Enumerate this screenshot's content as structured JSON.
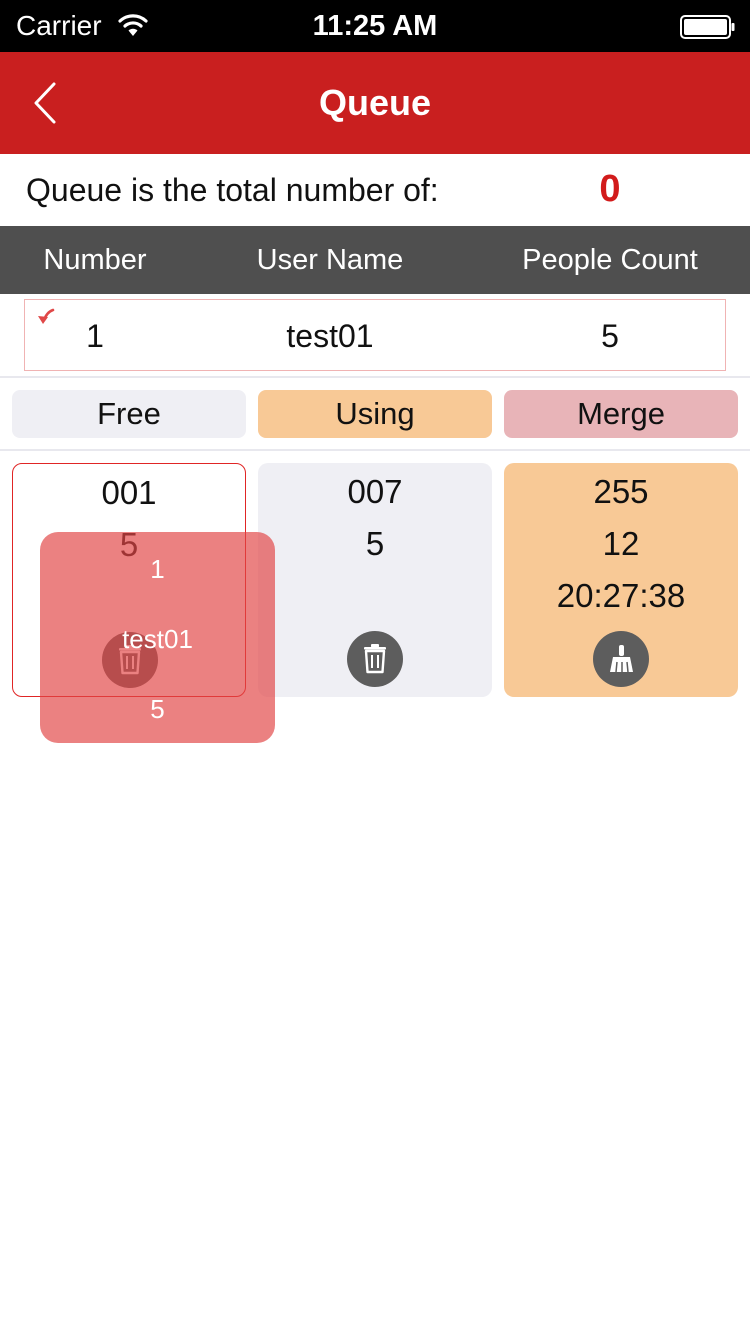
{
  "status_bar": {
    "carrier": "Carrier",
    "time": "11:25 AM",
    "icons": [
      "wifi-icon",
      "battery-icon"
    ]
  },
  "nav": {
    "title": "Queue",
    "back_icon": "chevron-left-icon"
  },
  "summary": {
    "label": "Queue is the total number of:",
    "value": "0",
    "value_color": "#d21b1b"
  },
  "table": {
    "columns": [
      "Number",
      "User Name",
      "People Count"
    ],
    "rows": [
      {
        "number": "1",
        "user_name": "test01",
        "people_count": "5"
      }
    ]
  },
  "tabs": [
    {
      "label": "Free",
      "color": "#efeff4"
    },
    {
      "label": "Using",
      "color": "#f8c996"
    },
    {
      "label": "Merge",
      "color": "#e8b4b8"
    }
  ],
  "cards": [
    {
      "lines": [
        "001",
        "5"
      ],
      "action_icon": "trash-icon",
      "state": "selected"
    },
    {
      "lines": [
        "007",
        "5"
      ],
      "action_icon": "trash-icon",
      "state": "free"
    },
    {
      "lines": [
        "255",
        "12",
        "20:27:38"
      ],
      "action_icon": "broom-icon",
      "state": "using"
    }
  ],
  "drag_item": {
    "number": "1",
    "user_name": "test01",
    "people_count": "5"
  },
  "colors": {
    "nav_red": "#c91f1f",
    "header_gray": "#4f4f4f",
    "overlay_red": "#e14646"
  }
}
